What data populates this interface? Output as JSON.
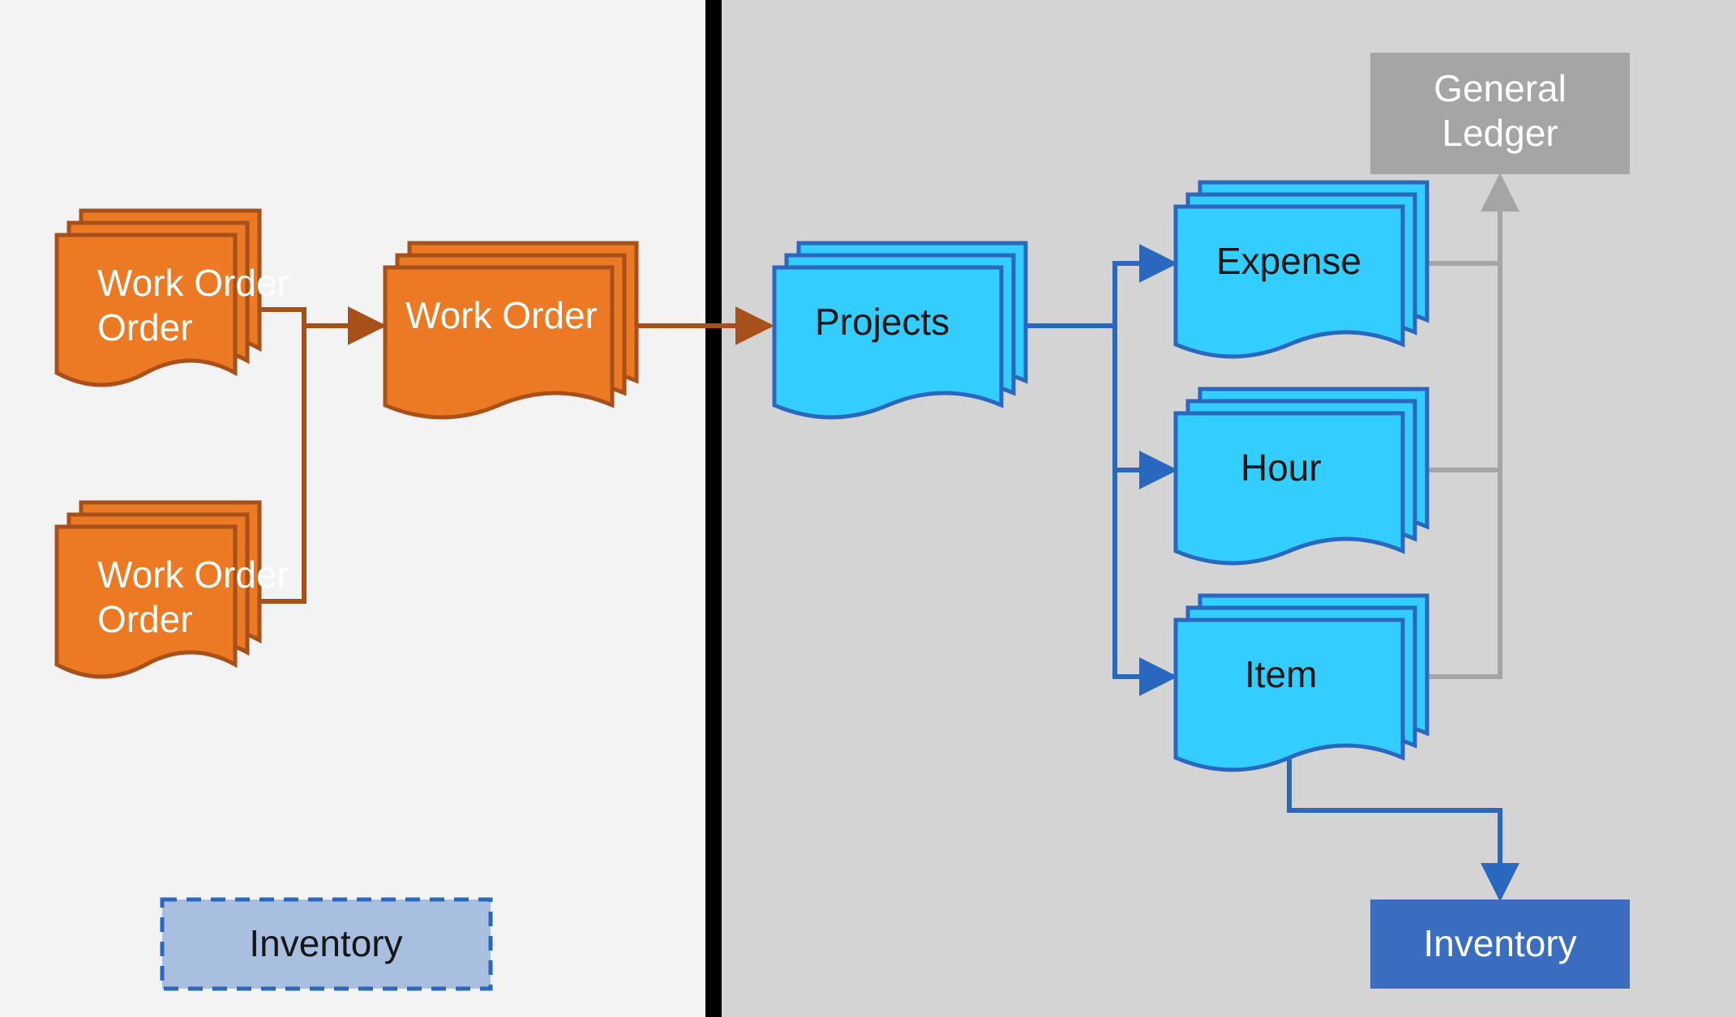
{
  "colors": {
    "left_bg": "#F3F3F3",
    "right_bg": "#D4D4D4",
    "divider": "#000000",
    "orange_fill": "#EC7A24",
    "orange_stroke": "#A8501A",
    "cyan_fill": "#33CDFF",
    "blue_stroke": "#2A67BE",
    "gray_box_fill": "#A5A5A5",
    "gray_box_text": "#FFFFFF",
    "gray_arrow": "#A5A5A5",
    "inventory_fill": "#3A6CC0",
    "inventory_text": "#FFFFFF",
    "dashed_fill": "#A9BFE0",
    "dashed_stroke": "#2A67BE",
    "text_dark": "#161616",
    "text_light": "#FFFFFF"
  },
  "nodes": {
    "work_order_1": "Work Order",
    "work_order_2": "Work Order",
    "work_order_3": "Work Order",
    "projects": "Projects",
    "expense": "Expense",
    "hour": "Hour",
    "item": "Item",
    "general_ledger_line1": "General",
    "general_ledger_line2": "Ledger",
    "inventory_right": "Inventory",
    "inventory_left": "Inventory"
  },
  "flow": {
    "description": "Work Orders (left panel) flow into a consolidated Work Order which flows into Projects (right panel). Projects branches into Expense, Hour, Item. Expense, Hour, Item feed the General Ledger. Item also feeds Inventory. A dashed Inventory placeholder sits on the left panel."
  }
}
